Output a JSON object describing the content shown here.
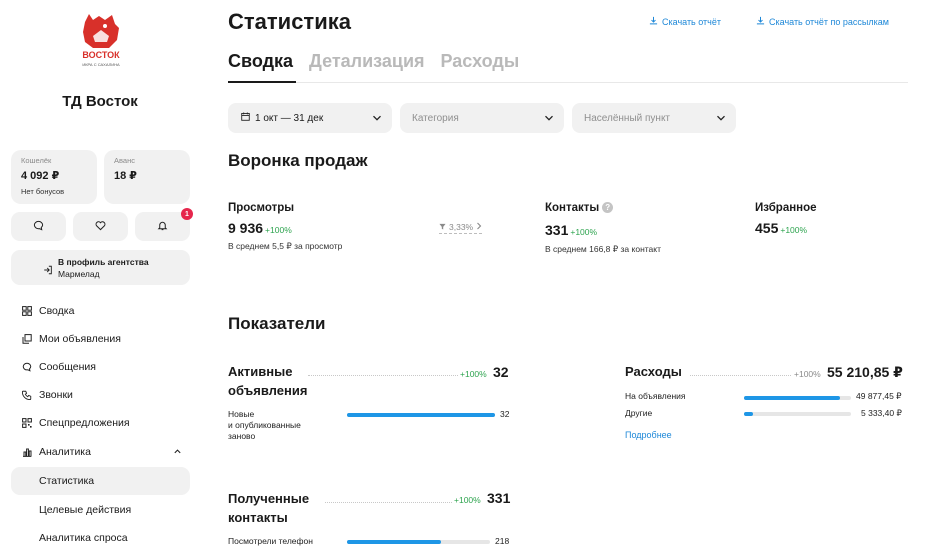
{
  "sidebar": {
    "logo_text": "ВОСТОК",
    "logo_subtext": "ИКРА С САХАЛИНА",
    "company_name": "ТД Восток",
    "wallet": {
      "label": "Кошелёк",
      "value": "4 092 ₽",
      "note": "Нет бонусов"
    },
    "advance": {
      "label": "Аванс",
      "value": "18 ₽"
    },
    "notifications_badge": "1",
    "agency": {
      "line1": "В профиль агентства",
      "line2": "Мармелад"
    },
    "nav": [
      {
        "label": "Сводка",
        "icon": "grid-icon"
      },
      {
        "label": "Мои объявления",
        "icon": "copy-icon"
      },
      {
        "label": "Сообщения",
        "icon": "chat-icon"
      },
      {
        "label": "Звонки",
        "icon": "phone-icon"
      },
      {
        "label": "Спецпредложения",
        "icon": "qr-icon"
      },
      {
        "label": "Аналитика",
        "icon": "bar-chart-icon"
      }
    ],
    "analytics_sub": [
      {
        "label": "Статистика"
      },
      {
        "label": "Целевые действия"
      },
      {
        "label": "Аналитика спроса"
      }
    ]
  },
  "main": {
    "title": "Статистика",
    "download_report": "Скачать отчёт",
    "download_mailing_report": "Скачать отчёт по рассылкам",
    "tabs": [
      {
        "label": "Сводка"
      },
      {
        "label": "Детализация"
      },
      {
        "label": "Расходы"
      }
    ],
    "filters": {
      "period": "1 окт — 31 дек",
      "category_placeholder": "Категория",
      "city_placeholder": "Населённый пункт"
    },
    "funnel": {
      "title": "Воронка продаж",
      "views": {
        "label": "Просмотры",
        "value": "9 936",
        "change": "+100%",
        "note": "В среднем 5,5 ₽ за просмотр"
      },
      "conversion": "3,33%",
      "contacts": {
        "label": "Контакты",
        "value": "331",
        "change": "+100%",
        "note": "В среднем 166,8 ₽ за контакт"
      },
      "favorites": {
        "label": "Избранное",
        "value": "455",
        "change": "+100%"
      }
    },
    "metrics": {
      "title": "Показатели",
      "active_ads": {
        "title_line1": "Активные",
        "title_line2": "объявления",
        "change": "+100%",
        "value": "32",
        "rows": [
          {
            "label_line1": "Новые",
            "label_line2": "и опубликованные",
            "label_line3": "заново",
            "value": "32",
            "fraction": 1.0
          }
        ]
      },
      "expenses": {
        "title": "Расходы",
        "change": "+100%",
        "value": "55 210,85 ₽",
        "rows": [
          {
            "label": "На объявления",
            "value": "49 877,45 ₽",
            "fraction": 0.9
          },
          {
            "label": "Другие",
            "value": "5 333,40 ₽",
            "fraction": 0.08
          }
        ],
        "more": "Подробнее"
      },
      "contacts_received": {
        "title_line1": "Полученные",
        "title_line2": "контакты",
        "change": "+100%",
        "value": "331",
        "rows": [
          {
            "label": "Посмотрели телефон",
            "value": "218",
            "fraction": 0.66
          }
        ]
      }
    }
  }
}
